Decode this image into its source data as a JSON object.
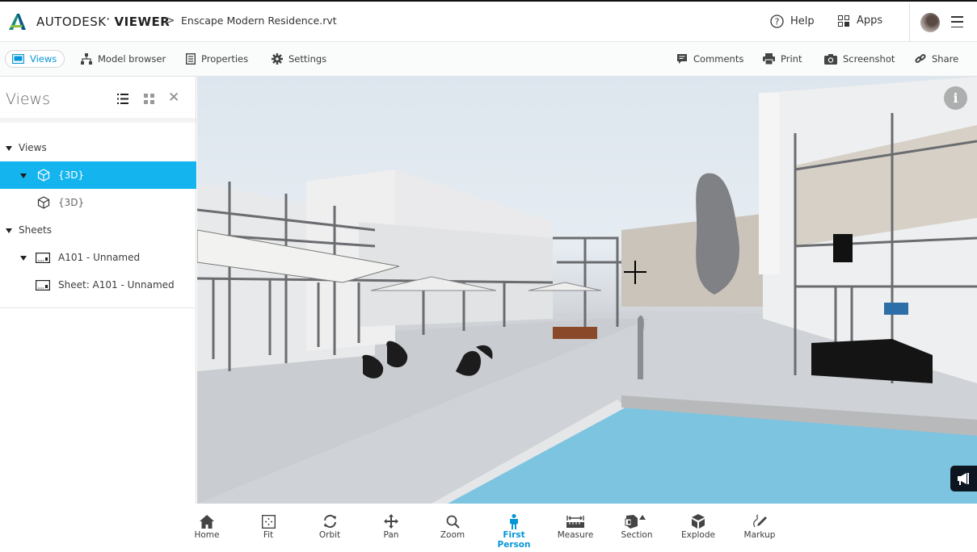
{
  "header": {
    "brand_light": "AUTODESK",
    "brand_bold": "VIEWER",
    "breadcrumb_separator": ">",
    "file_name": "Enscape Modern Residence.rvt",
    "help_label": "Help",
    "apps_label": "Apps"
  },
  "toolbar": {
    "left": [
      {
        "label": "Views",
        "icon": "views-icon",
        "active": true
      },
      {
        "label": "Model browser",
        "icon": "hierarchy-icon"
      },
      {
        "label": "Properties",
        "icon": "document-icon"
      },
      {
        "label": "Settings",
        "icon": "gear-icon"
      }
    ],
    "right": [
      {
        "label": "Comments",
        "icon": "comment-icon"
      },
      {
        "label": "Print",
        "icon": "printer-icon"
      },
      {
        "label": "Screenshot",
        "icon": "camera-icon"
      },
      {
        "label": "Share",
        "icon": "link-icon"
      }
    ]
  },
  "panel": {
    "title": "Views",
    "close_glyph": "✕",
    "tree": [
      {
        "label": "Views",
        "level": 0,
        "expanded": true,
        "bold": true
      },
      {
        "label": "{3D}",
        "level": 1,
        "expanded": true,
        "icon": "cube-icon",
        "selected": true
      },
      {
        "label": "{3D}",
        "level": 2,
        "icon": "cube-icon"
      },
      {
        "label": "Sheets",
        "level": 0,
        "expanded": true,
        "bold": true
      },
      {
        "label": "A101 - Unnamed",
        "level": 1,
        "expanded": true,
        "icon": "sheet-icon"
      },
      {
        "label": "Sheet: A101 - Unnamed",
        "level": 2,
        "icon": "sheet-icon"
      }
    ]
  },
  "viewport": {
    "info_glyph": "i"
  },
  "bottom_tools": [
    {
      "label": "Home",
      "icon": "home-icon"
    },
    {
      "label": "Fit",
      "icon": "fit-icon"
    },
    {
      "label": "Orbit",
      "icon": "orbit-icon"
    },
    {
      "label": "Pan",
      "icon": "pan-icon"
    },
    {
      "label": "Zoom",
      "icon": "zoom-icon"
    },
    {
      "label": "First Person",
      "icon": "person-icon",
      "active": true
    },
    {
      "label": "Measure",
      "icon": "measure-icon"
    },
    {
      "label": "Section",
      "icon": "section-icon"
    },
    {
      "label": "Explode",
      "icon": "explode-icon"
    },
    {
      "label": "Markup",
      "icon": "markup-icon"
    }
  ],
  "colors": {
    "accent": "#0696d7",
    "selection": "#14b5ef",
    "pool": "#7cc4e0"
  }
}
